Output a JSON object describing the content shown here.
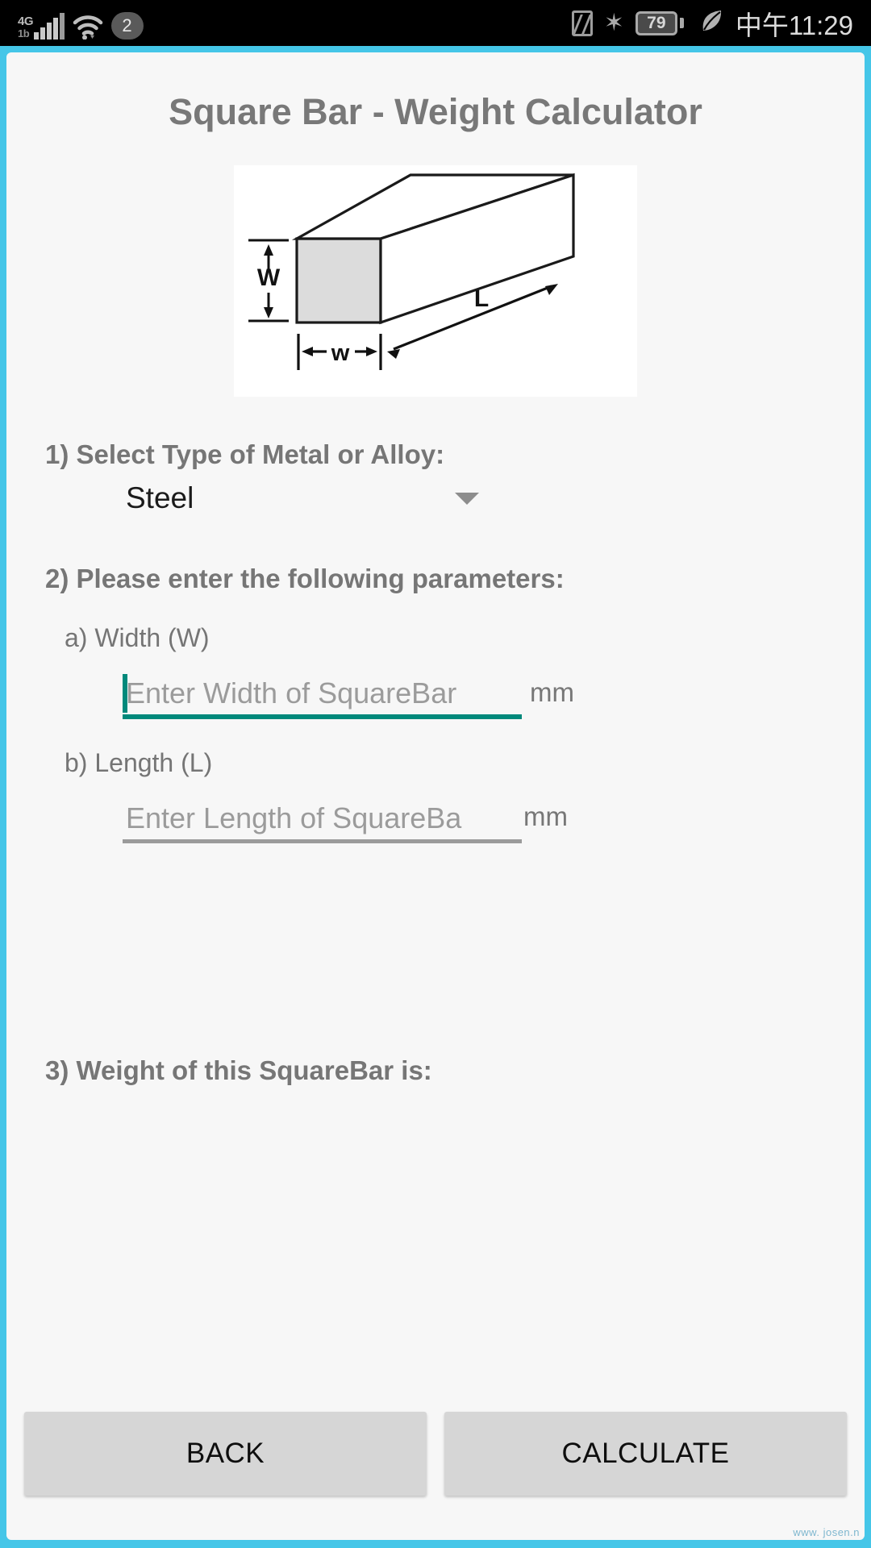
{
  "status_bar": {
    "network_type": "4G",
    "network_sub": "1b",
    "notification_badge": "2",
    "icons": [
      "signal-icon",
      "wifi-icon",
      "nfc-icon",
      "bluetooth-icon",
      "battery-icon",
      "leaf-eco-icon"
    ],
    "battery_level": "79",
    "clock": "中午11:29"
  },
  "app": {
    "title": "Square Bar - Weight Calculator",
    "accent_border_color": "#45c6e8",
    "background_color": "#f7f7f7",
    "focus_accent_color": "#00897b"
  },
  "diagram": {
    "name": "square-bar-isometric-diagram",
    "labels": {
      "height": "W",
      "width": "w",
      "length": "L"
    }
  },
  "form": {
    "step1_label": "1) Select Type of Metal or Alloy:",
    "metal_selected": "Steel",
    "metal_options": [
      "Steel"
    ],
    "step2_label": "2) Please enter the following parameters:",
    "fields": [
      {
        "label": "a) Width (W)",
        "placeholder": "Enter Width of SquareBar",
        "value": "",
        "unit": "mm",
        "focused": true
      },
      {
        "label": "b) Length (L)",
        "placeholder": "Enter Length of SquareBa",
        "value": "",
        "unit": "mm",
        "focused": false
      }
    ],
    "step3_label": "3) Weight of this SquareBar is:",
    "result_value": ""
  },
  "buttons": {
    "back": "BACK",
    "calculate": "CALCULATE"
  },
  "watermark": "www. josen.n"
}
